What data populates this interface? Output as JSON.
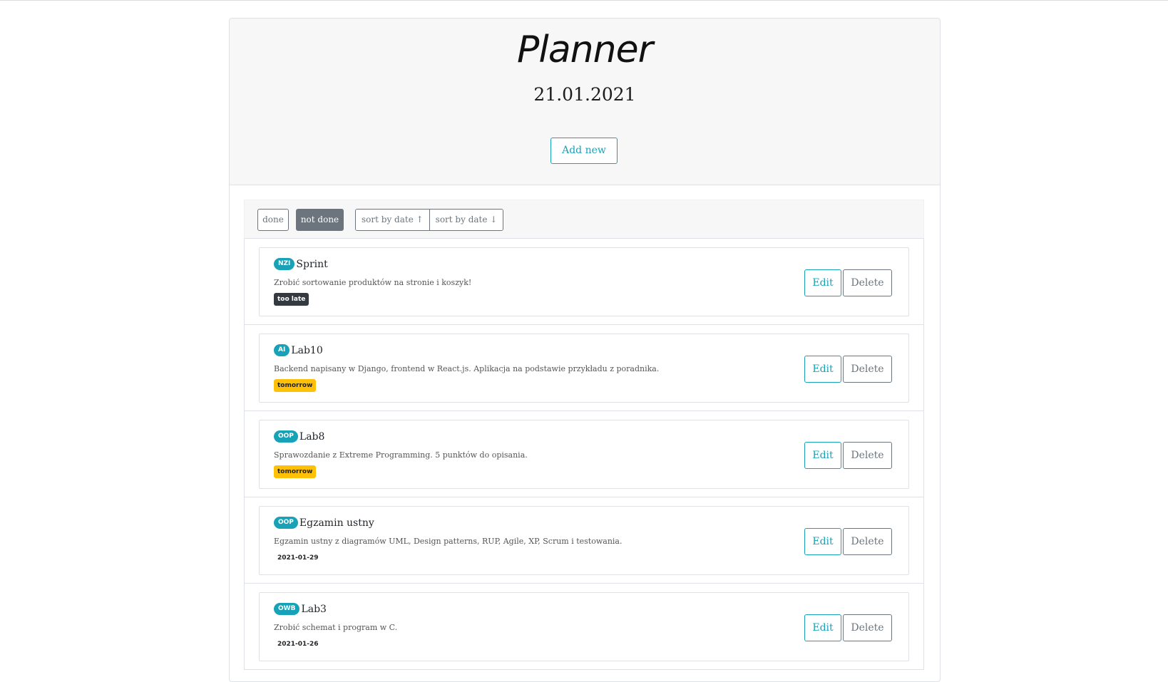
{
  "header": {
    "title": "Planner",
    "date": "21.01.2021",
    "add_button": "Add new"
  },
  "filters": {
    "done": "done",
    "not_done": "not done",
    "active": "not done",
    "sort_asc": "sort by date ↑",
    "sort_desc": "sort by date ↓"
  },
  "tasks": [
    {
      "tag": "NZI",
      "title": "Sprint",
      "description": "Zrobić sortowanie produktów na stronie i koszyk!",
      "due": "too late",
      "due_style": "late",
      "edit": "Edit",
      "delete": "Delete"
    },
    {
      "tag": "AI",
      "title": "Lab10",
      "description": "Backend napisany w Django, frontend w React.js. Aplikacja na podstawie przykładu z poradnika.",
      "due": "tomorrow",
      "due_style": "soon",
      "edit": "Edit",
      "delete": "Delete"
    },
    {
      "tag": "OOP",
      "title": "Lab8",
      "description": "Sprawozdanie z Extreme Programming. 5 punktów do opisania.",
      "due": "tomorrow",
      "due_style": "soon",
      "edit": "Edit",
      "delete": "Delete"
    },
    {
      "tag": "OOP",
      "title": "Egzamin ustny",
      "description": "Egzamin ustny z diagramów UML, Design patterns, RUP, Agile, XP, Scrum i testowania.",
      "due": "2021-01-29",
      "due_style": "plain",
      "edit": "Edit",
      "delete": "Delete"
    },
    {
      "tag": "OWB",
      "title": "Lab3",
      "description": "Zrobić schemat i program w C.",
      "due": "2021-01-26",
      "due_style": "plain",
      "edit": "Edit",
      "delete": "Delete"
    }
  ],
  "colors": {
    "primary": "#17a2b8",
    "secondary": "#6c757d",
    "late": "#343a40",
    "soon": "#ffc107",
    "header_bg": "#f7f7f7"
  }
}
